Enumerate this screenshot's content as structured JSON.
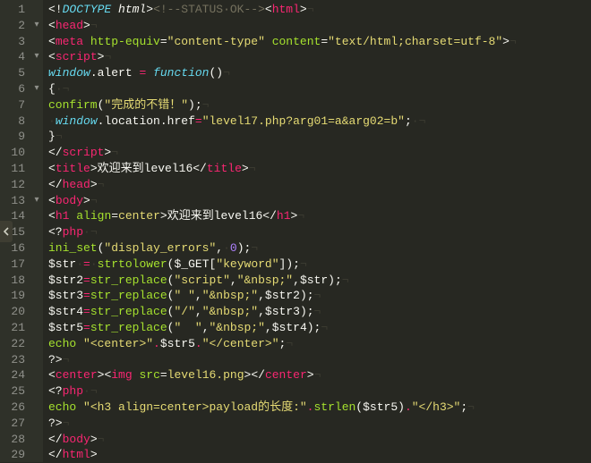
{
  "editor": {
    "fold_markers": [
      "",
      "▾",
      "",
      "▾",
      "",
      "▾",
      "",
      "",
      "",
      "",
      "",
      "",
      "▾",
      "",
      "",
      "",
      "",
      "",
      "",
      "",
      "",
      "",
      "",
      "",
      "",
      "",
      "",
      "",
      ""
    ],
    "lines": [
      {
        "n": 1,
        "tokens": [
          {
            "t": "<!",
            "c": "c-ang"
          },
          {
            "t": "DOCTYPE",
            "c": "c-doc"
          },
          {
            "t": " ",
            "c": "c-plain"
          },
          {
            "t": "html",
            "c": "c-plain c-doc"
          },
          {
            "t": ">",
            "c": "c-ang"
          },
          {
            "t": "<!--STATUS·OK-->",
            "c": "c-cmt"
          },
          {
            "t": "<",
            "c": "c-ang"
          },
          {
            "t": "html",
            "c": "c-tag"
          },
          {
            "t": ">",
            "c": "c-ang"
          },
          {
            "t": "¬",
            "c": "c-white"
          }
        ]
      },
      {
        "n": 2,
        "tokens": [
          {
            "t": "<",
            "c": "c-ang"
          },
          {
            "t": "head",
            "c": "c-tag"
          },
          {
            "t": ">",
            "c": "c-ang"
          },
          {
            "t": "¬",
            "c": "c-white"
          }
        ]
      },
      {
        "n": 3,
        "tokens": [
          {
            "t": "<",
            "c": "c-ang"
          },
          {
            "t": "meta",
            "c": "c-tag"
          },
          {
            "t": " ",
            "c": "c-plain"
          },
          {
            "t": "http-equiv",
            "c": "c-attr"
          },
          {
            "t": "=",
            "c": "c-plain"
          },
          {
            "t": "\"content-type\"",
            "c": "c-str"
          },
          {
            "t": " ",
            "c": "c-plain"
          },
          {
            "t": "content",
            "c": "c-attr"
          },
          {
            "t": "=",
            "c": "c-plain"
          },
          {
            "t": "\"text/html;charset=utf-8\"",
            "c": "c-str"
          },
          {
            "t": ">",
            "c": "c-ang"
          },
          {
            "t": "¬",
            "c": "c-white"
          }
        ]
      },
      {
        "n": 4,
        "tokens": [
          {
            "t": "<",
            "c": "c-ang"
          },
          {
            "t": "script",
            "c": "c-tag"
          },
          {
            "t": ">",
            "c": "c-ang"
          },
          {
            "t": "¬",
            "c": "c-white"
          }
        ]
      },
      {
        "n": 5,
        "tokens": [
          {
            "t": "window",
            "c": "c-ent"
          },
          {
            "t": ".",
            "c": "c-plain"
          },
          {
            "t": "alert",
            "c": "c-plain"
          },
          {
            "t": " ",
            "c": "c-plain"
          },
          {
            "t": "=",
            "c": "c-op"
          },
          {
            "t": " ",
            "c": "c-plain"
          },
          {
            "t": "function",
            "c": "c-kw"
          },
          {
            "t": "()",
            "c": "c-plain"
          },
          {
            "t": "¬",
            "c": "c-white"
          }
        ]
      },
      {
        "n": 6,
        "tokens": [
          {
            "t": "{",
            "c": "c-plain"
          },
          {
            "t": "·¬",
            "c": "c-white"
          }
        ]
      },
      {
        "n": 7,
        "tokens": [
          {
            "t": "confirm",
            "c": "c-fn"
          },
          {
            "t": "(",
            "c": "c-plain"
          },
          {
            "t": "\"完成的不错！\"",
            "c": "c-str"
          },
          {
            "t": ");",
            "c": "c-plain"
          },
          {
            "t": "¬",
            "c": "c-white"
          }
        ]
      },
      {
        "n": 8,
        "tokens": [
          {
            "t": "·",
            "c": "c-white"
          },
          {
            "t": "window",
            "c": "c-ent"
          },
          {
            "t": ".",
            "c": "c-plain"
          },
          {
            "t": "location",
            "c": "c-plain"
          },
          {
            "t": ".",
            "c": "c-plain"
          },
          {
            "t": "href",
            "c": "c-plain"
          },
          {
            "t": "=",
            "c": "c-op"
          },
          {
            "t": "\"level17.php?arg01=a&arg02=b\"",
            "c": "c-str"
          },
          {
            "t": ";",
            "c": "c-plain"
          },
          {
            "t": "·¬",
            "c": "c-white"
          }
        ]
      },
      {
        "n": 9,
        "tokens": [
          {
            "t": "}",
            "c": "c-plain"
          },
          {
            "t": "¬",
            "c": "c-white"
          }
        ]
      },
      {
        "n": 10,
        "tokens": [
          {
            "t": "</",
            "c": "c-ang"
          },
          {
            "t": "script",
            "c": "c-tag"
          },
          {
            "t": ">",
            "c": "c-ang"
          },
          {
            "t": "¬",
            "c": "c-white"
          }
        ]
      },
      {
        "n": 11,
        "tokens": [
          {
            "t": "<",
            "c": "c-ang"
          },
          {
            "t": "title",
            "c": "c-tag"
          },
          {
            "t": ">",
            "c": "c-ang"
          },
          {
            "t": "欢迎来到level16",
            "c": "c-plain"
          },
          {
            "t": "</",
            "c": "c-ang"
          },
          {
            "t": "title",
            "c": "c-tag"
          },
          {
            "t": ">",
            "c": "c-ang"
          },
          {
            "t": "¬",
            "c": "c-white"
          }
        ]
      },
      {
        "n": 12,
        "tokens": [
          {
            "t": "</",
            "c": "c-ang"
          },
          {
            "t": "head",
            "c": "c-tag"
          },
          {
            "t": ">",
            "c": "c-ang"
          },
          {
            "t": "¬",
            "c": "c-white"
          }
        ]
      },
      {
        "n": 13,
        "tokens": [
          {
            "t": "<",
            "c": "c-ang"
          },
          {
            "t": "body",
            "c": "c-tag"
          },
          {
            "t": ">",
            "c": "c-ang"
          },
          {
            "t": "¬",
            "c": "c-white"
          }
        ]
      },
      {
        "n": 14,
        "tokens": [
          {
            "t": "<",
            "c": "c-ang"
          },
          {
            "t": "h1",
            "c": "c-tag"
          },
          {
            "t": " ",
            "c": "c-plain"
          },
          {
            "t": "align",
            "c": "c-attr"
          },
          {
            "t": "=",
            "c": "c-plain"
          },
          {
            "t": "center",
            "c": "c-str"
          },
          {
            "t": ">",
            "c": "c-ang"
          },
          {
            "t": "欢迎来到level16",
            "c": "c-plain"
          },
          {
            "t": "</",
            "c": "c-ang"
          },
          {
            "t": "h1",
            "c": "c-tag"
          },
          {
            "t": ">",
            "c": "c-ang"
          },
          {
            "t": "¬",
            "c": "c-white"
          }
        ]
      },
      {
        "n": 15,
        "tokens": [
          {
            "t": "<?",
            "c": "c-phpd"
          },
          {
            "t": "php",
            "c": "c-op"
          },
          {
            "t": "·¬",
            "c": "c-white"
          }
        ]
      },
      {
        "n": 16,
        "tokens": [
          {
            "t": "ini_set",
            "c": "c-fn"
          },
          {
            "t": "(",
            "c": "c-plain"
          },
          {
            "t": "\"display_errors\"",
            "c": "c-str"
          },
          {
            "t": ",",
            "c": "c-plain"
          },
          {
            "t": "·",
            "c": "c-white"
          },
          {
            "t": "0",
            "c": "c-num"
          },
          {
            "t": ");",
            "c": "c-plain"
          },
          {
            "t": "¬",
            "c": "c-white"
          }
        ]
      },
      {
        "n": 17,
        "tokens": [
          {
            "t": "$str",
            "c": "c-var"
          },
          {
            "t": "·",
            "c": "c-white"
          },
          {
            "t": "=",
            "c": "c-op"
          },
          {
            "t": "·",
            "c": "c-white"
          },
          {
            "t": "strtolower",
            "c": "c-fn"
          },
          {
            "t": "(",
            "c": "c-plain"
          },
          {
            "t": "$_GET",
            "c": "c-var"
          },
          {
            "t": "[",
            "c": "c-plain"
          },
          {
            "t": "\"keyword\"",
            "c": "c-str"
          },
          {
            "t": "]);",
            "c": "c-plain"
          },
          {
            "t": "¬",
            "c": "c-white"
          }
        ]
      },
      {
        "n": 18,
        "tokens": [
          {
            "t": "$str2",
            "c": "c-var"
          },
          {
            "t": "=",
            "c": "c-op"
          },
          {
            "t": "str_replace",
            "c": "c-fn"
          },
          {
            "t": "(",
            "c": "c-plain"
          },
          {
            "t": "\"script\"",
            "c": "c-str"
          },
          {
            "t": ",",
            "c": "c-plain"
          },
          {
            "t": "\"&nbsp;\"",
            "c": "c-str"
          },
          {
            "t": ",",
            "c": "c-plain"
          },
          {
            "t": "$str",
            "c": "c-var"
          },
          {
            "t": ");",
            "c": "c-plain"
          },
          {
            "t": "¬",
            "c": "c-white"
          }
        ]
      },
      {
        "n": 19,
        "tokens": [
          {
            "t": "$str3",
            "c": "c-var"
          },
          {
            "t": "=",
            "c": "c-op"
          },
          {
            "t": "str_replace",
            "c": "c-fn"
          },
          {
            "t": "(",
            "c": "c-plain"
          },
          {
            "t": "\" \"",
            "c": "c-str"
          },
          {
            "t": ",",
            "c": "c-plain"
          },
          {
            "t": "\"&nbsp;\"",
            "c": "c-str"
          },
          {
            "t": ",",
            "c": "c-plain"
          },
          {
            "t": "$str2",
            "c": "c-var"
          },
          {
            "t": ");",
            "c": "c-plain"
          },
          {
            "t": "¬",
            "c": "c-white"
          }
        ]
      },
      {
        "n": 20,
        "tokens": [
          {
            "t": "$str4",
            "c": "c-var"
          },
          {
            "t": "=",
            "c": "c-op"
          },
          {
            "t": "str_replace",
            "c": "c-fn"
          },
          {
            "t": "(",
            "c": "c-plain"
          },
          {
            "t": "\"/\"",
            "c": "c-str"
          },
          {
            "t": ",",
            "c": "c-plain"
          },
          {
            "t": "\"&nbsp;\"",
            "c": "c-str"
          },
          {
            "t": ",",
            "c": "c-plain"
          },
          {
            "t": "$str3",
            "c": "c-var"
          },
          {
            "t": ");",
            "c": "c-plain"
          },
          {
            "t": "¬",
            "c": "c-white"
          }
        ]
      },
      {
        "n": 21,
        "tokens": [
          {
            "t": "$str5",
            "c": "c-var"
          },
          {
            "t": "=",
            "c": "c-op"
          },
          {
            "t": "str_replace",
            "c": "c-fn"
          },
          {
            "t": "(",
            "c": "c-plain"
          },
          {
            "t": "\"  \"",
            "c": "c-str"
          },
          {
            "t": ",",
            "c": "c-plain"
          },
          {
            "t": "\"&nbsp;\"",
            "c": "c-str"
          },
          {
            "t": ",",
            "c": "c-plain"
          },
          {
            "t": "$str4",
            "c": "c-var"
          },
          {
            "t": ");",
            "c": "c-plain"
          },
          {
            "t": "¬",
            "c": "c-white"
          }
        ]
      },
      {
        "n": 22,
        "tokens": [
          {
            "t": "echo",
            "c": "c-fn"
          },
          {
            "t": " ",
            "c": "c-plain"
          },
          {
            "t": "\"<center>\"",
            "c": "c-str"
          },
          {
            "t": ".",
            "c": "c-op"
          },
          {
            "t": "$str5",
            "c": "c-var"
          },
          {
            "t": ".",
            "c": "c-op"
          },
          {
            "t": "\"</center>\"",
            "c": "c-str"
          },
          {
            "t": ";",
            "c": "c-plain"
          },
          {
            "t": "¬",
            "c": "c-white"
          }
        ]
      },
      {
        "n": 23,
        "tokens": [
          {
            "t": "?>",
            "c": "c-phpd"
          },
          {
            "t": "¬",
            "c": "c-white"
          }
        ]
      },
      {
        "n": 24,
        "tokens": [
          {
            "t": "<",
            "c": "c-ang"
          },
          {
            "t": "center",
            "c": "c-tag"
          },
          {
            "t": ">",
            "c": "c-ang"
          },
          {
            "t": "<",
            "c": "c-ang"
          },
          {
            "t": "img",
            "c": "c-tag"
          },
          {
            "t": " ",
            "c": "c-plain"
          },
          {
            "t": "src",
            "c": "c-attr"
          },
          {
            "t": "=",
            "c": "c-plain"
          },
          {
            "t": "level16.png",
            "c": "c-str"
          },
          {
            "t": ">",
            "c": "c-ang"
          },
          {
            "t": "</",
            "c": "c-ang"
          },
          {
            "t": "center",
            "c": "c-tag"
          },
          {
            "t": ">",
            "c": "c-ang"
          },
          {
            "t": "¬",
            "c": "c-white"
          }
        ]
      },
      {
        "n": 25,
        "tokens": [
          {
            "t": "<?",
            "c": "c-phpd"
          },
          {
            "t": "php",
            "c": "c-op"
          },
          {
            "t": "·¬",
            "c": "c-white"
          }
        ]
      },
      {
        "n": 26,
        "tokens": [
          {
            "t": "echo",
            "c": "c-fn"
          },
          {
            "t": " ",
            "c": "c-plain"
          },
          {
            "t": "\"<h3 align=center>payload的长度:\"",
            "c": "c-str"
          },
          {
            "t": ".",
            "c": "c-op"
          },
          {
            "t": "strlen",
            "c": "c-fn"
          },
          {
            "t": "(",
            "c": "c-plain"
          },
          {
            "t": "$str5",
            "c": "c-var"
          },
          {
            "t": ")",
            "c": "c-plain"
          },
          {
            "t": ".",
            "c": "c-op"
          },
          {
            "t": "\"</h3>\"",
            "c": "c-str"
          },
          {
            "t": ";",
            "c": "c-plain"
          },
          {
            "t": "¬",
            "c": "c-white"
          }
        ]
      },
      {
        "n": 27,
        "tokens": [
          {
            "t": "?>",
            "c": "c-phpd"
          },
          {
            "t": "¬",
            "c": "c-white"
          }
        ]
      },
      {
        "n": 28,
        "tokens": [
          {
            "t": "</",
            "c": "c-ang"
          },
          {
            "t": "body",
            "c": "c-tag"
          },
          {
            "t": ">",
            "c": "c-ang"
          },
          {
            "t": "¬",
            "c": "c-white"
          }
        ]
      },
      {
        "n": 29,
        "tokens": [
          {
            "t": "</",
            "c": "c-ang"
          },
          {
            "t": "html",
            "c": "c-tag"
          },
          {
            "t": ">",
            "c": "c-ang"
          }
        ]
      }
    ]
  }
}
